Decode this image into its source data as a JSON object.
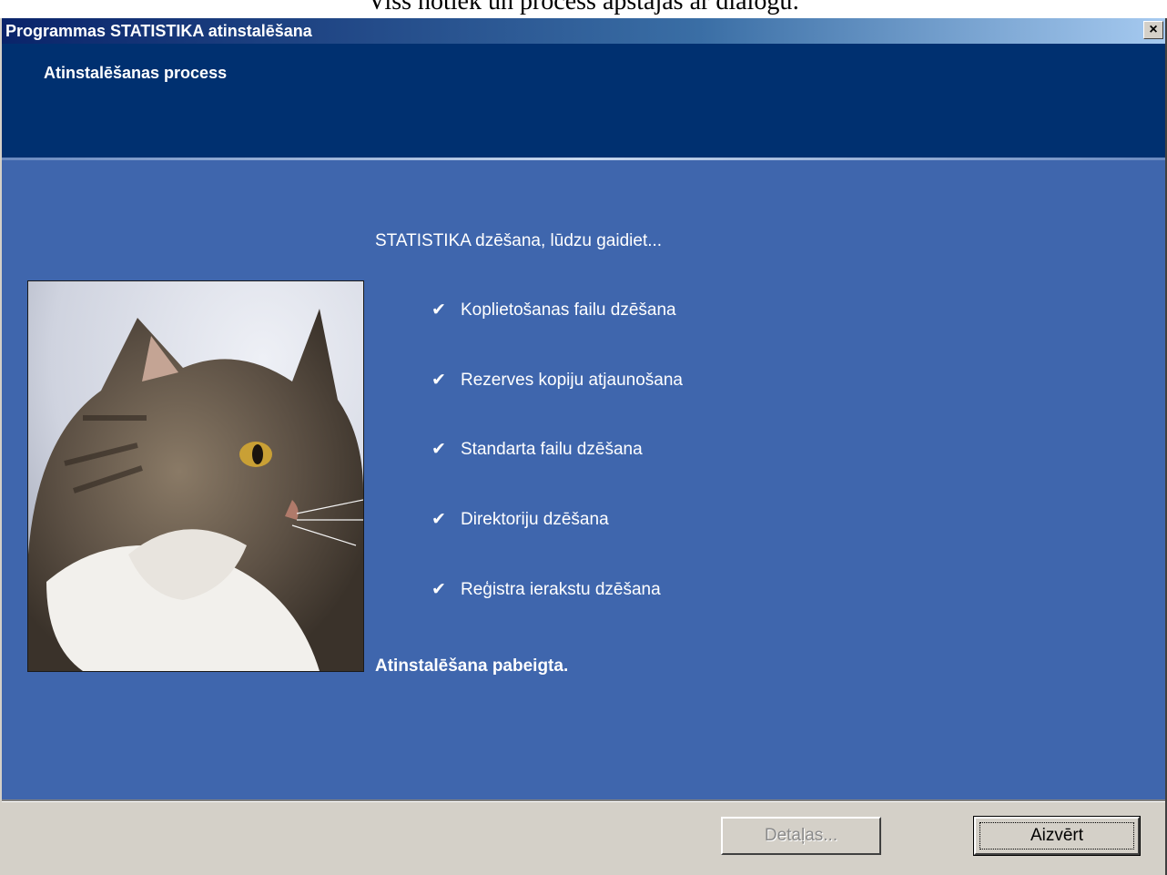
{
  "caption": "Viss notiek un process apstājas ar dialogu:",
  "window": {
    "title": "Programmas STATISTIKA atinstalēšana",
    "close_glyph": "×"
  },
  "header": {
    "heading": "Atinstalēšanas process"
  },
  "content": {
    "status": "STATISTIKA dzēšana, lūdzu gaidiet...",
    "tasks": [
      {
        "label": "Koplietošanas failu dzēšana",
        "check": "✔"
      },
      {
        "label": "Rezerves kopiju atjaunošana",
        "check": "✔"
      },
      {
        "label": "Standarta failu dzēšana",
        "check": "✔"
      },
      {
        "label": "Direktoriju dzēšana",
        "check": "✔"
      },
      {
        "label": "Reģistra ierakstu dzēšana",
        "check": "✔"
      }
    ],
    "completion": "Atinstalēšana pabeigta."
  },
  "buttons": {
    "details": "Detaļas...",
    "close": "Aizvērt"
  },
  "colors": {
    "header_band": "#003070",
    "content_bg": "#3f66ad",
    "dialog_face": "#d4d0c8"
  }
}
